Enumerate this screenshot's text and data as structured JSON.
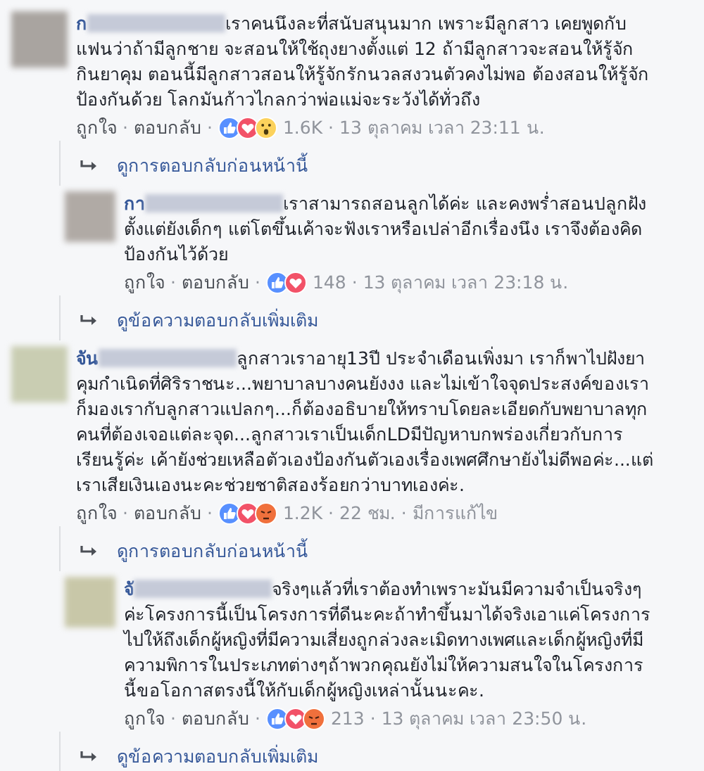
{
  "separator": "·",
  "items": [
    {
      "kind": "comment",
      "name": "ก",
      "text": "เราคนนึงละที่สนับสนุนมาก เพราะมีลูกสาว เคยพูดกับแฟนว่าถ้ามีลูกชาย จะสอนให้ใช้ถุงยางตั้งแต่ 12 ถ้ามีลูกสาวจะสอนให้รู้จักกินยาคุม ตอนนี้มีลูกสาวสอนให้รู้จักรักนวลสงวนตัวคงไม่พอ ต้องสอนให้รู้จักป้องกันด้วย โลกมันก้าวไกลกว่าพ่อแม่จะระวังได้ทั่วถึง",
      "like": "ถูกใจ",
      "reply": "ตอบกลับ",
      "reactions": [
        {
          "kind": "like"
        },
        {
          "kind": "love"
        },
        {
          "kind": "wow"
        }
      ],
      "count": "1.6K",
      "time": "13 ตุลาคม เวลา 23:11 น."
    },
    {
      "kind": "link",
      "text": "ดูการตอบกลับก่อนหน้านี้"
    },
    {
      "kind": "reply",
      "name": "กา",
      "text": "เราสามารถสอนลูกได้ค่ะ และคงพร่ำสอนปลูกฝังตั้งแต่ยังเด็กๆ แต่โตขึ้นเค้าจะฟังเราหรือเปล่าอีกเรื่องนึง เราจึงต้องคิดป้องกันไว้ด้วย",
      "like": "ถูกใจ",
      "reply": "ตอบกลับ",
      "reactions": [
        {
          "kind": "like"
        },
        {
          "kind": "love"
        }
      ],
      "count": "148",
      "time": "13 ตุลาคม เวลา 23:18 น."
    },
    {
      "kind": "link",
      "text": "ดูข้อความตอบกลับเพิ่มเติม"
    },
    {
      "kind": "comment",
      "name": "จัน",
      "text": "ลูกสาวเราอายุ13ปี ประจำเดือนเพิ่งมา เราก็พาไปฝังยาคุมกำเนิดที่ศิริราชนะ...พยาบาลบางคนยังงง และไม่เข้าใจจุดประสงค์ของเราก็มองเรากับลูกสาวแปลกๆ...ก็ต้องอธิบายให้ทราบโดยละเอียดกับพยาบาลทุกคนที่ต้องเจอแต่ละจุด...ลูกสาวเราเป็นเด็กLDมีปัญหาบกพร่องเกี่ยวกับการเรียนรู้ค่ะ เค้ายังช่วยเหลือตัวเองป้องกันตัวเองเรื่องเพศศึกษายังไม่ดีพอค่ะ...แต่เราเสียเงินเองนะคะช่วยชาติสองร้อยกว่าบาทเองค่ะ.",
      "like": "ถูกใจ",
      "reply": "ตอบกลับ",
      "reactions": [
        {
          "kind": "like"
        },
        {
          "kind": "love"
        },
        {
          "kind": "angry"
        }
      ],
      "count": "1.2K",
      "time": "22 ชม.",
      "edited": "มีการแก้ไข"
    },
    {
      "kind": "link",
      "text": "ดูการตอบกลับก่อนหน้านี้"
    },
    {
      "kind": "reply",
      "name": "จั",
      "text": "จริงๆแล้วที่เราต้องทำเพราะมันมีความจำเป็นจริงๆค่ะโครงการนี้เป็นโครงการที่ดีนะคะถ้าทำขึ้นมาได้จริงเอาแค่โครงการไปให้ถึงเด็กผู้หญิงที่มีความเสี่ยงถูกล่วงละเมิดทางเพศและเด็กผู้หญิงที่มีความพิการในประเภทต่างๆถ้าพวกคุณยังไม่ให้ความสนใจในโครงการนี้ขอโอกาสตรงนี้ให้กับเด็กผู้หญิงเหล่านั้นนะคะ.",
      "like": "ถูกใจ",
      "reply": "ตอบกลับ",
      "reactions": [
        {
          "kind": "like"
        },
        {
          "kind": "love"
        },
        {
          "kind": "angry"
        }
      ],
      "count": "213",
      "time": "13 ตุลาคม เวลา 23:50 น."
    },
    {
      "kind": "link",
      "text": "ดูข้อความตอบกลับเพิ่มเติม"
    }
  ]
}
